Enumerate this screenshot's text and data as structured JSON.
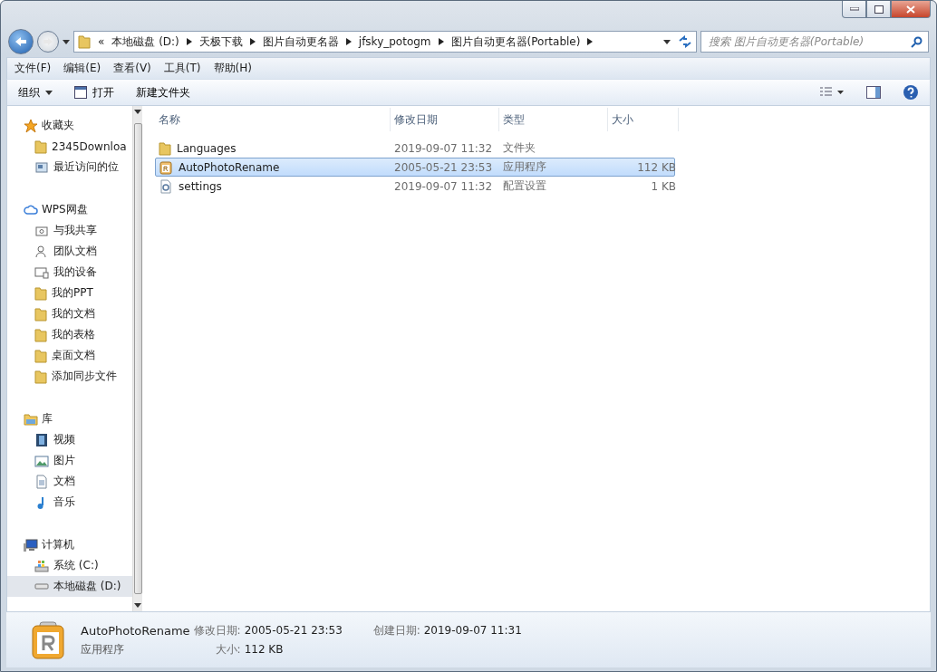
{
  "address": {
    "overflow": "«",
    "crumbs": [
      "本地磁盘 (D:)",
      "天极下载",
      "图片自动更名器",
      "jfsky_potogm",
      "图片自动更名器(Portable)"
    ]
  },
  "search": {
    "placeholder": "搜索 图片自动更名器(Portable)"
  },
  "menu": [
    "文件(F)",
    "编辑(E)",
    "查看(V)",
    "工具(T)",
    "帮助(H)"
  ],
  "toolbar": [
    {
      "label": "组织",
      "kind": "dropdown"
    },
    {
      "label": "打开",
      "kind": "open"
    },
    {
      "label": "新建文件夹",
      "kind": "plain"
    }
  ],
  "sidebar": [
    {
      "label": "收藏夹",
      "kind": "favorites",
      "children": [
        {
          "label": "2345Downloa",
          "kind": "folder",
          "selected": false
        },
        {
          "label": "最近访问的位",
          "kind": "recent",
          "selected": false
        }
      ]
    },
    {
      "label": "WPS网盘",
      "kind": "cloud",
      "children": [
        {
          "label": "与我共享",
          "kind": "share",
          "selected": false
        },
        {
          "label": "团队文档",
          "kind": "team",
          "selected": false
        },
        {
          "label": "我的设备",
          "kind": "device",
          "selected": false
        },
        {
          "label": "我的PPT",
          "kind": "folder",
          "selected": false
        },
        {
          "label": "我的文档",
          "kind": "folder",
          "selected": false
        },
        {
          "label": "我的表格",
          "kind": "folder",
          "selected": false
        },
        {
          "label": "桌面文档",
          "kind": "folder",
          "selected": false
        },
        {
          "label": "添加同步文件",
          "kind": "folder",
          "selected": false
        }
      ]
    },
    {
      "label": "库",
      "kind": "library",
      "children": [
        {
          "label": "视频",
          "kind": "video",
          "selected": false
        },
        {
          "label": "图片",
          "kind": "picture",
          "selected": false
        },
        {
          "label": "文档",
          "kind": "doc",
          "selected": false
        },
        {
          "label": "音乐",
          "kind": "music",
          "selected": false
        }
      ]
    },
    {
      "label": "计算机",
      "kind": "computer",
      "children": [
        {
          "label": "系统 (C:)",
          "kind": "system",
          "selected": false
        },
        {
          "label": "本地磁盘 (D:)",
          "kind": "drive",
          "selected": true
        }
      ]
    }
  ],
  "table": {
    "columns": [
      "名称",
      "修改日期",
      "类型",
      "大小"
    ],
    "rows": [
      {
        "name": "Languages",
        "kind": "folder",
        "date": "2019-09-07 11:32",
        "type": "文件夹",
        "selected": false
      },
      {
        "name": "AutoPhotoRename",
        "kind": "app",
        "date": "2005-05-21 23:53",
        "type": "应用程序",
        "size": "112 KB",
        "selected": true
      },
      {
        "name": "settings",
        "kind": "config",
        "date": "2019-09-07 11:32",
        "type": "配置设置",
        "size": "1 KB",
        "selected": false
      }
    ]
  },
  "details": {
    "name": "AutoPhotoRename",
    "type": "应用程序",
    "modified_label": "修改日期:",
    "modified": "2005-05-21 23:53",
    "size_label": "大小:",
    "size": "112 KB",
    "created_label": "创建日期:",
    "created": "2019-09-07 11:31"
  }
}
